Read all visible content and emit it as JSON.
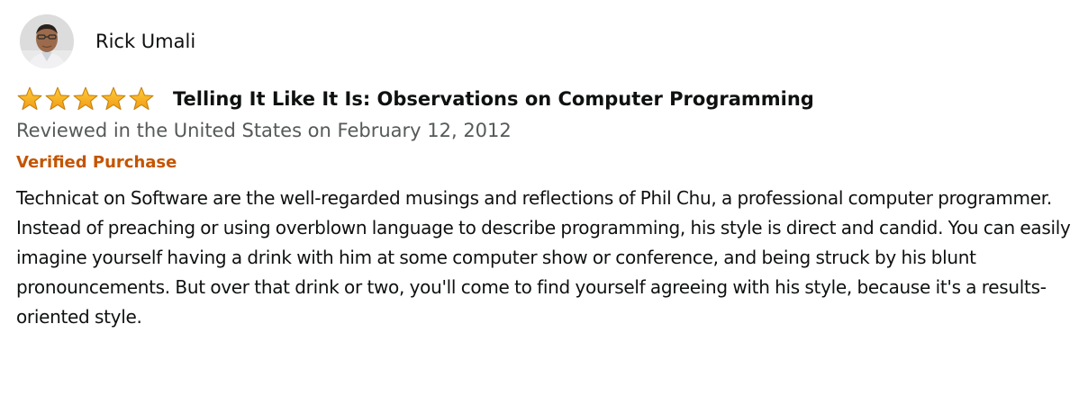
{
  "reviewer": {
    "name": "Rick Umali",
    "avatar_icon": "profile-photo"
  },
  "rating": {
    "value": 5,
    "max": 5,
    "star_color": "#f7a51c"
  },
  "review": {
    "title": "Telling It Like It Is: Observations on Computer Programming",
    "date_line": "Reviewed in the United States on February 12, 2012",
    "badge": "Verified Purchase",
    "body": "Technicat on Software are the well-regarded musings and reflections of Phil Chu, a professional computer programmer. Instead of preaching or using overblown language to describe programming, his style is direct and candid. You can easily imagine yourself having a drink with him at some computer show or conference, and being struck by his blunt pronouncements. But over that drink or two, you'll come to find yourself agreeing with his style, because it's a results-oriented style."
  },
  "colors": {
    "text": "#0f1111",
    "secondary_text": "#565959",
    "badge": "#c45500"
  }
}
